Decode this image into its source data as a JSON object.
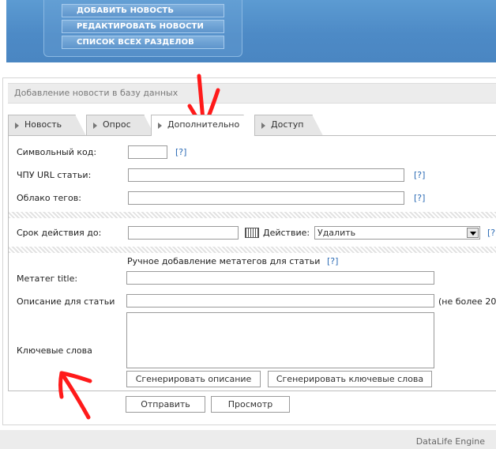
{
  "menu": {
    "items": [
      "ДОБАВИТЬ НОВОСТЬ",
      "РЕДАКТИРОВАТЬ НОВОСТИ",
      "СПИСОК ВСЕХ РАЗДЕЛОВ"
    ]
  },
  "panel": {
    "title": "Добавление новости в базу данных"
  },
  "tabs": [
    {
      "label": "Новость"
    },
    {
      "label": "Опрос"
    },
    {
      "label": "Дополнительно"
    },
    {
      "label": "Доступ"
    }
  ],
  "form": {
    "symbolic_code_label": "Символьный код:",
    "url_label": "ЧПУ URL статьи:",
    "tags_label": "Облако тегов:",
    "help": "[?]",
    "expiry_label": "Срок действия до:",
    "action_label": "Действие:",
    "action_value": "Удалить",
    "meta_heading": "Ручное добавление метатегов для статьи",
    "meta_title_label": "Метатег title:",
    "description_label": "Описание для статьи",
    "description_note": "(не более 20",
    "keywords_label": "Ключевые слова",
    "gen_description_button": "Сгенерировать описание",
    "gen_keywords_button": "Сгенерировать ключевые слова",
    "submit_button": "Отправить",
    "preview_button": "Просмотр"
  },
  "footer": {
    "text": "DataLife Engine"
  },
  "colors": {
    "header_blue": "#4d8ac6",
    "link_blue": "#2a6ab4",
    "annotation_red": "#ff1a1a"
  }
}
